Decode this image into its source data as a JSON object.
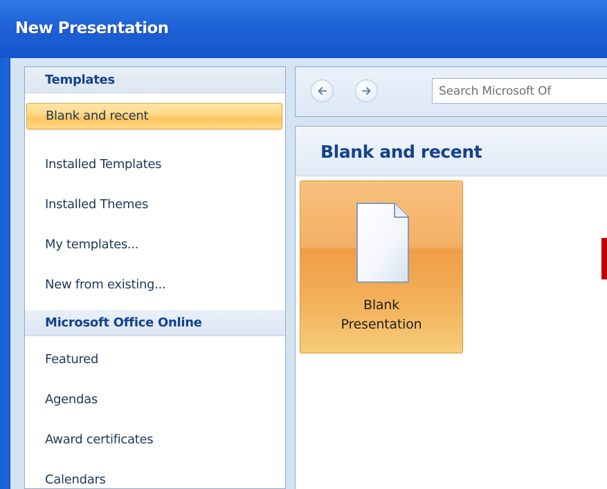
{
  "window": {
    "title": "New Presentation"
  },
  "sidebar": {
    "sections": [
      {
        "header": "Templates",
        "items": [
          {
            "label": "Blank and recent",
            "selected": true
          },
          {
            "label": "Installed Templates",
            "selected": false
          },
          {
            "label": "Installed Themes",
            "selected": false
          },
          {
            "label": "My templates...",
            "selected": false
          },
          {
            "label": "New from existing...",
            "selected": false
          }
        ]
      },
      {
        "header": "Microsoft Office Online",
        "items": [
          {
            "label": "Featured",
            "selected": false
          },
          {
            "label": "Agendas",
            "selected": false
          },
          {
            "label": "Award certificates",
            "selected": false
          },
          {
            "label": "Calendars",
            "selected": false
          }
        ]
      }
    ]
  },
  "toolbar": {
    "back_icon": "back-arrow-icon",
    "forward_icon": "forward-arrow-icon",
    "search_placeholder": "Search Microsoft Of"
  },
  "main": {
    "title": "Blank and recent",
    "tiles": [
      {
        "line1": "Blank",
        "line2": "Presentation",
        "icon": "blank-document-icon",
        "selected": true
      }
    ]
  },
  "colors": {
    "title_bar": "#1e62d7",
    "selection_orange": "#ffc55e",
    "header_text": "#15428b",
    "accent_red": "#c00000"
  }
}
